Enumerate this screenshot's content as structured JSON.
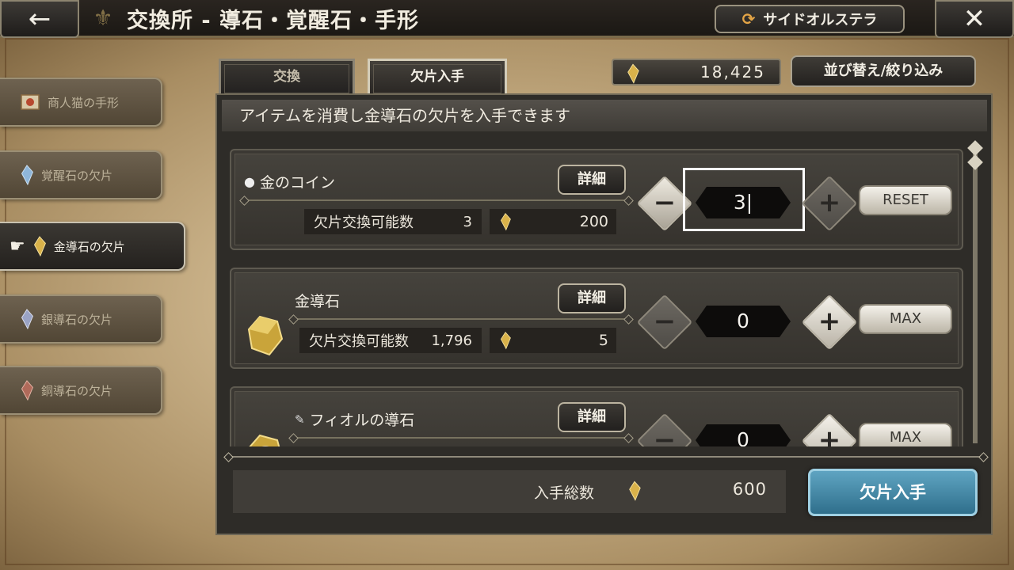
{
  "header": {
    "back_label": "←",
    "title": "交換所 - 導石・覚醒石・手形",
    "world_button": "サイドオルステラ",
    "close_label": "✕"
  },
  "sidebar": {
    "items": [
      {
        "label": "商人猫の手形",
        "active": false
      },
      {
        "label": "覚醒石の欠片",
        "active": false
      },
      {
        "label": "金導石の欠片",
        "active": true
      },
      {
        "label": "銀導石の欠片",
        "active": false
      },
      {
        "label": "銅導石の欠片",
        "active": false
      }
    ]
  },
  "tabs": [
    {
      "label": "交換",
      "active": false
    },
    {
      "label": "欠片入手",
      "active": true
    }
  ],
  "currency": {
    "value": "18,425"
  },
  "sort_button": "並び替え/絞り込み",
  "description": "アイテムを消費し金導石の欠片を入手できます",
  "detail_label": "詳細",
  "stat_label": "欠片交換可能数",
  "rows": [
    {
      "name": "金のコイン",
      "available": "3",
      "cost": "200",
      "quantity": "3|",
      "action": "RESET"
    },
    {
      "name": "金導石",
      "available": "1,796",
      "cost": "5",
      "quantity": "0",
      "action": "MAX"
    },
    {
      "name": "フィオルの導石",
      "available": "",
      "cost": "",
      "quantity": "0",
      "action": "MAX"
    }
  ],
  "footer": {
    "total_label": "入手総数",
    "total_value": "600",
    "get_button": "欠片入手"
  },
  "colors": {
    "accent_blue": "#3f87a8",
    "gold": "#d9b24a",
    "panel": "#2e2c28"
  }
}
